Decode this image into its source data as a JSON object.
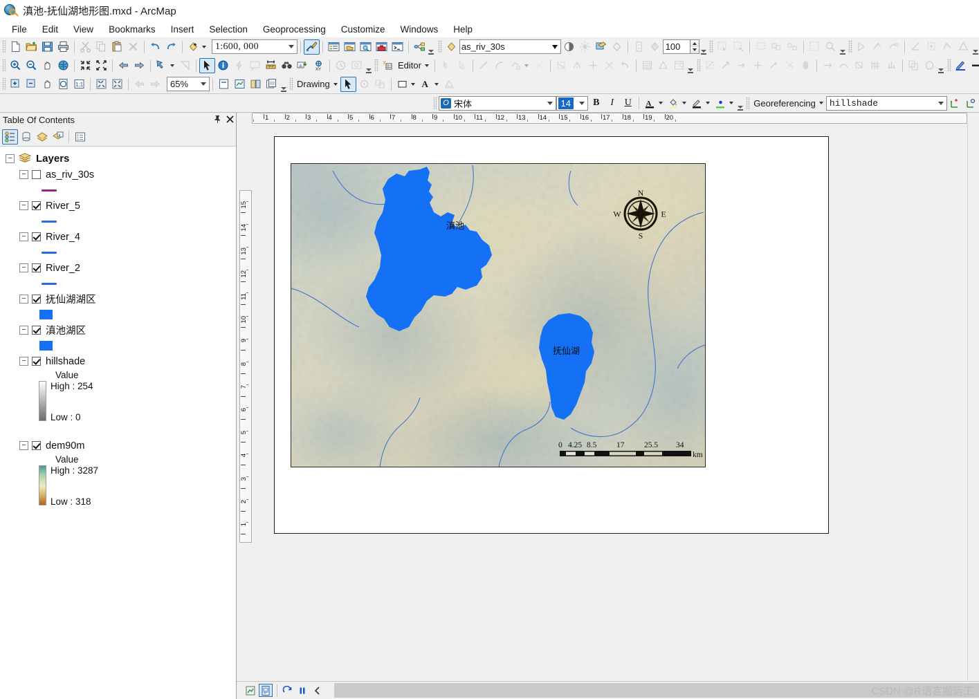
{
  "window": {
    "title": "滇池-抚仙湖地形图.mxd - ArcMap",
    "app_icon": "arcmap-globe-icon"
  },
  "menubar": {
    "items": [
      "File",
      "Edit",
      "View",
      "Bookmarks",
      "Insert",
      "Selection",
      "Geoprocessing",
      "Customize",
      "Windows",
      "Help"
    ]
  },
  "standard_toolbar": {
    "buttons": [
      {
        "name": "new-map-button",
        "icon": "new-document-icon"
      },
      {
        "name": "open-button",
        "icon": "open-folder-icon"
      },
      {
        "name": "save-button",
        "icon": "floppy-disk-icon"
      },
      {
        "name": "print-button",
        "icon": "printer-icon"
      },
      {
        "name": "cut-button",
        "icon": "scissors-icon"
      },
      {
        "name": "copy-button",
        "icon": "copy-icon"
      },
      {
        "name": "paste-button",
        "icon": "clipboard-icon"
      },
      {
        "name": "delete-button",
        "icon": "delete-x-icon"
      },
      {
        "name": "undo-button",
        "icon": "undo-arrow-icon"
      },
      {
        "name": "redo-button",
        "icon": "redo-arrow-icon"
      },
      {
        "name": "add-data-button",
        "icon": "add-data-icon"
      }
    ],
    "scale_label": "1:600, 000",
    "right_buttons": [
      {
        "name": "editor-toolbar-button",
        "icon": "edit-vertex-icon"
      },
      {
        "name": "table-of-contents-button",
        "icon": "toc-window-icon"
      },
      {
        "name": "catalog-window-button",
        "icon": "catalog-window-icon"
      },
      {
        "name": "search-window-button",
        "icon": "search-window-icon"
      },
      {
        "name": "arctoolbox-button",
        "icon": "arctoolbox-icon"
      },
      {
        "name": "python-window-button",
        "icon": "python-window-icon"
      },
      {
        "name": "model-builder-button",
        "icon": "model-builder-icon"
      }
    ]
  },
  "tools_toolbar": {
    "buttons": [
      {
        "name": "zoom-in-button",
        "icon": "magnifier-plus-icon"
      },
      {
        "name": "zoom-out-button",
        "icon": "magnifier-minus-icon"
      },
      {
        "name": "pan-button",
        "icon": "hand-icon"
      },
      {
        "name": "full-extent-button",
        "icon": "globe-icon"
      },
      {
        "name": "fixed-zoom-in-button",
        "icon": "arrows-in-icon"
      },
      {
        "name": "fixed-zoom-out-button",
        "icon": "arrows-out-icon"
      },
      {
        "name": "go-back-extent-button",
        "icon": "arrow-left-icon"
      },
      {
        "name": "go-next-extent-button",
        "icon": "arrow-right-icon"
      },
      {
        "name": "select-features-button",
        "icon": "select-features-icon"
      },
      {
        "name": "clear-selection-button",
        "icon": "clear-selection-icon"
      },
      {
        "name": "select-elements-button",
        "icon": "arrow-pointer-icon"
      },
      {
        "name": "identify-button",
        "icon": "info-circle-icon"
      },
      {
        "name": "hyperlink-button",
        "icon": "lightning-icon"
      },
      {
        "name": "html-popup-button",
        "icon": "popup-icon"
      },
      {
        "name": "measure-button",
        "icon": "ruler-icon"
      },
      {
        "name": "find-button",
        "icon": "binoculars-icon"
      },
      {
        "name": "find-route-button",
        "icon": "route-icon"
      },
      {
        "name": "go-to-xy-button",
        "icon": "xy-target-icon"
      },
      {
        "name": "time-slider-button",
        "icon": "clock-icon"
      },
      {
        "name": "create-viewer-button",
        "icon": "viewer-window-icon"
      }
    ],
    "editor_label": "Editor"
  },
  "layout_toolbar": {
    "buttons": [
      {
        "name": "layout-zoom-in-button",
        "icon": "page-zoom-in-icon"
      },
      {
        "name": "layout-zoom-out-button",
        "icon": "page-zoom-out-icon"
      },
      {
        "name": "layout-pan-button",
        "icon": "hand-icon"
      },
      {
        "name": "zoom-whole-page-button",
        "icon": "whole-page-icon"
      },
      {
        "name": "zoom-100-percent-button",
        "icon": "one-to-one-icon"
      },
      {
        "name": "fixed-zoom-in-page-button",
        "icon": "arrows-in-icon"
      },
      {
        "name": "fixed-zoom-out-page-button",
        "icon": "arrows-out-icon"
      },
      {
        "name": "back-extent-button",
        "icon": "arrow-left-icon"
      },
      {
        "name": "forward-extent-button",
        "icon": "arrow-right-icon"
      }
    ],
    "zoom_value": "65%",
    "right_buttons": [
      {
        "name": "toggle-draft-mode-button",
        "icon": "draft-page-icon"
      },
      {
        "name": "focus-data-frame-button",
        "icon": "focus-frame-icon"
      },
      {
        "name": "change-layout-button",
        "icon": "change-layout-icon"
      },
      {
        "name": "data-driven-pages-button",
        "icon": "data-driven-icon"
      }
    ],
    "drawing_label": "Drawing"
  },
  "effects_toolbar": {
    "layer_value": "as_riv_30s",
    "transparency_value": "100",
    "buttons": [
      {
        "name": "contrast-button",
        "icon": "contrast-icon"
      },
      {
        "name": "brightness-button",
        "icon": "brightness-sun-icon"
      },
      {
        "name": "swipe-button",
        "icon": "swipe-layer-icon"
      },
      {
        "name": "flicker-button",
        "icon": "flicker-diamond-icon"
      },
      {
        "name": "transparency-button",
        "icon": "transparency-icon"
      },
      {
        "name": "flicker-speed-button",
        "icon": "flicker-speed-icon"
      }
    ]
  },
  "font_toolbar": {
    "font_name": "宋体",
    "font_size": "14",
    "bold_label": "B",
    "italic_label": "I",
    "underline_label": "U",
    "font_color_label": "A",
    "buttons": [
      {
        "name": "bold-button",
        "icon": "bold-icon"
      },
      {
        "name": "italic-button",
        "icon": "italic-icon"
      },
      {
        "name": "underline-button",
        "icon": "underline-icon"
      },
      {
        "name": "font-color-button",
        "icon": "font-color-icon"
      },
      {
        "name": "fill-color-button",
        "icon": "fill-color-icon"
      },
      {
        "name": "line-color-button",
        "icon": "line-color-icon"
      },
      {
        "name": "marker-color-button",
        "icon": "marker-color-icon"
      }
    ]
  },
  "georeferencing_toolbar": {
    "menu_label": "Georeferencing",
    "layer_value": "hillshade"
  },
  "table_of_contents": {
    "title": "Table Of Contents",
    "pin_icon": "pin-icon",
    "close_icon": "close-icon",
    "toolbar": [
      {
        "name": "list-by-drawing-order-button",
        "icon": "drawing-order-icon",
        "selected": true
      },
      {
        "name": "list-by-source-button",
        "icon": "source-icon",
        "selected": false
      },
      {
        "name": "list-by-visibility-button",
        "icon": "visibility-icon",
        "selected": false
      },
      {
        "name": "list-by-selection-button",
        "icon": "selection-icon",
        "selected": false
      },
      {
        "name": "toc-options-button",
        "icon": "options-list-icon",
        "selected": false
      }
    ],
    "root": "Layers",
    "layers": [
      {
        "name": "as_riv_30s",
        "checked": false,
        "symbol": "line",
        "color": "#8e2a8e"
      },
      {
        "name": "River_5",
        "checked": true,
        "symbol": "line",
        "color": "#2a6fd8"
      },
      {
        "name": "River_4",
        "checked": true,
        "symbol": "line",
        "color": "#2a6fd8"
      },
      {
        "name": "River_2",
        "checked": true,
        "symbol": "line",
        "color": "#2a6fd8"
      },
      {
        "name": "抚仙湖湖区",
        "checked": true,
        "symbol": "polygon",
        "color": "#1470f5"
      },
      {
        "name": "滇池湖区",
        "checked": true,
        "symbol": "polygon",
        "color": "#1470f5"
      },
      {
        "name": "hillshade",
        "checked": true,
        "symbol": "raster",
        "value_label": "Value",
        "high_label": "High : 254",
        "low_label": "Low : 0",
        "ramp_from": "#ffffff",
        "ramp_to": "#6b6b6b"
      },
      {
        "name": "dem90m",
        "checked": true,
        "symbol": "raster",
        "value_label": "Value",
        "high_label": "High : 3287",
        "low_label": "Low : 318",
        "ramp_from": "#3f9e9c",
        "ramp_to": "#b5631b"
      }
    ]
  },
  "layout_view": {
    "ruler_horizontal": [
      "1",
      "2",
      "3",
      "4",
      "5",
      "6",
      "7",
      "8",
      "9",
      "10",
      "11",
      "12",
      "13",
      "14",
      "15",
      "16",
      "17",
      "18",
      "19",
      "20"
    ],
    "ruler_vertical": [
      "1",
      "2",
      "3",
      "4",
      "5",
      "6",
      "7",
      "8",
      "9",
      "10",
      "11",
      "12",
      "13",
      "14",
      "15"
    ],
    "map_labels": [
      {
        "name": "dianchi-lake-label",
        "text": "滇池"
      },
      {
        "name": "fuxian-lake-label",
        "text": "抚仙湖"
      }
    ],
    "north_arrow": {
      "n": "N",
      "e": "E",
      "s": "S",
      "w": "W"
    },
    "scale_bar": {
      "ticks": [
        "0",
        "4.25",
        "8.5",
        "17",
        "25.5",
        "34"
      ],
      "units": "km"
    }
  },
  "statusbar": {
    "buttons": [
      {
        "name": "data-view-button",
        "icon": "data-view-icon",
        "selected": false
      },
      {
        "name": "layout-view-button",
        "icon": "layout-view-icon",
        "selected": true
      },
      {
        "name": "refresh-view-button",
        "icon": "refresh-icon",
        "selected": false
      },
      {
        "name": "pause-drawing-button",
        "icon": "pause-icon",
        "selected": false
      },
      {
        "name": "toggle-panel-button",
        "icon": "chevron-left-icon",
        "selected": false
      }
    ],
    "watermark": "CSDN @R语言搬运工"
  }
}
